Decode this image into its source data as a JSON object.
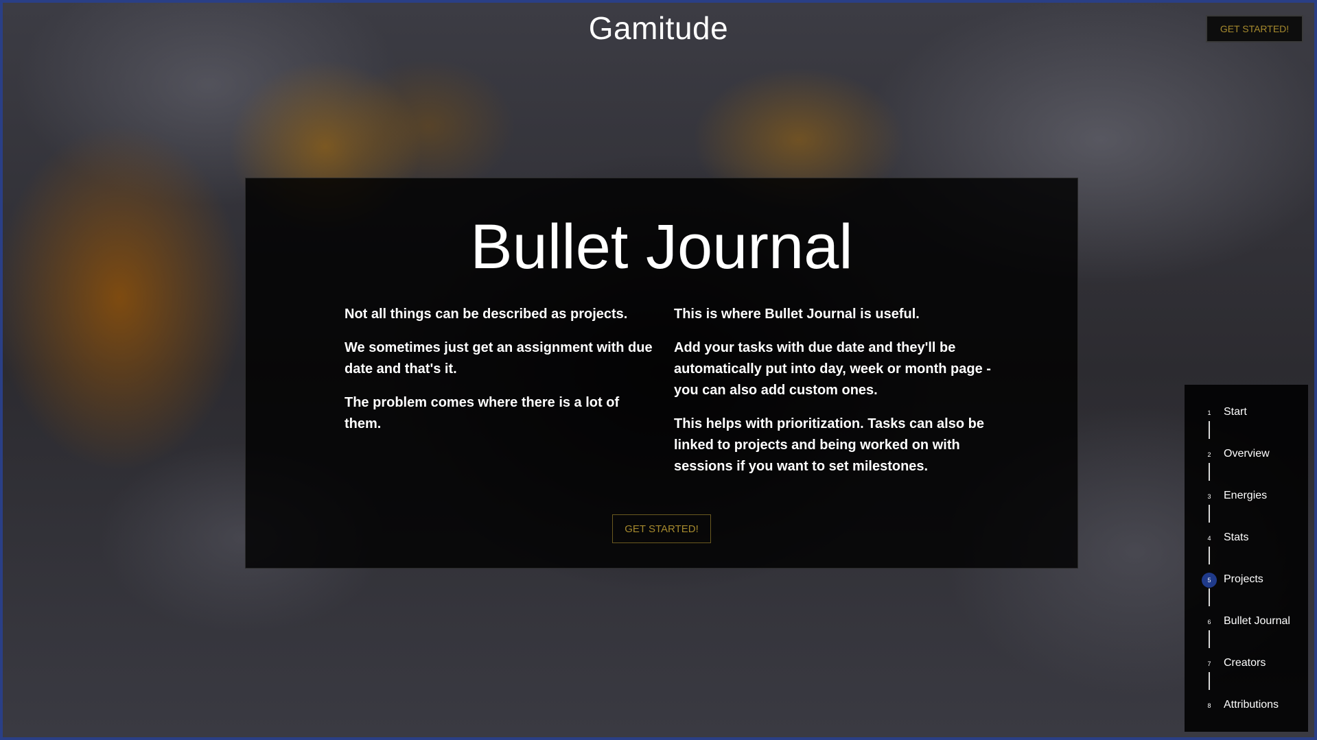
{
  "header": {
    "title": "Gamitude",
    "cta_label": "GET STARTED!"
  },
  "section": {
    "title": "Bullet Journal",
    "left_paragraphs": [
      "Not all things can be described as projects.",
      "We sometimes just get an assignment with due date and that's it.",
      "The problem comes where there is a lot of them."
    ],
    "right_paragraphs": [
      "This is where Bullet Journal is useful.",
      "Add your tasks with due date and they'll be automatically put into day, week or month page - you can also add custom ones.",
      "This helps with prioritization. Tasks can also be linked to projects and being worked on with sessions if you want to set milestones."
    ],
    "cta_label": "GET STARTED!"
  },
  "nav": {
    "active_index": 5,
    "active_color": "#1f3a8a",
    "items": [
      {
        "num": "1",
        "label": "Start"
      },
      {
        "num": "2",
        "label": "Overview"
      },
      {
        "num": "3",
        "label": "Energies"
      },
      {
        "num": "4",
        "label": "Stats"
      },
      {
        "num": "5",
        "label": "Projects"
      },
      {
        "num": "6",
        "label": "Bullet Journal"
      },
      {
        "num": "7",
        "label": "Creators"
      },
      {
        "num": "8",
        "label": "Attributions"
      }
    ]
  },
  "colors": {
    "accent_gold": "#a68a2e",
    "frame_blue": "#2a3f86"
  }
}
